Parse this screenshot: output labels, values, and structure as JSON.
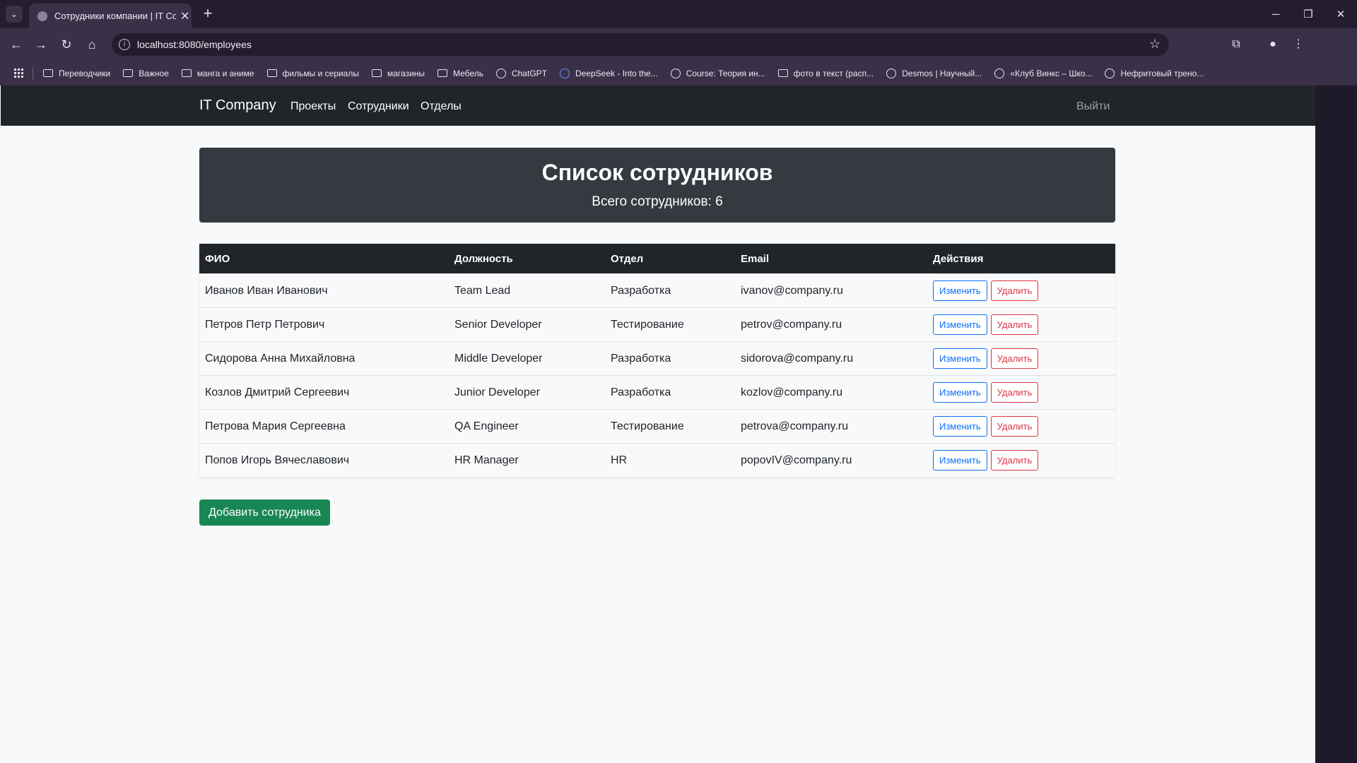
{
  "browser": {
    "tab_title": "Сотрудники компании | IT Co",
    "new_tab": "+",
    "url": "localhost:8080/employees",
    "bookmarks": [
      "Переводчики",
      "Важное",
      "манга и аниме",
      "фильмы и сериалы",
      "магазины",
      "Мебель",
      "ChatGPT",
      "DeepSeek - Into the...",
      "Course: Теория ин...",
      "фото в текст (расп...",
      "Desmos | Научный...",
      "«Клуб Винкс – Шко...",
      "Нефритовый трено..."
    ]
  },
  "navbar": {
    "brand": "IT Company",
    "links": [
      "Проекты",
      "Сотрудники",
      "Отделы"
    ],
    "logout": "Выйти"
  },
  "header": {
    "title": "Список сотрудников",
    "subtitle": "Всего сотрудников: 6"
  },
  "table": {
    "columns": [
      "ФИО",
      "Должность",
      "Отдел",
      "Email",
      "Действия"
    ],
    "rows": [
      {
        "name": "Иванов Иван Иванович",
        "position": "Team Lead",
        "department": "Разработка",
        "email": "ivanov@company.ru"
      },
      {
        "name": "Петров Петр Петрович",
        "position": "Senior Developer",
        "department": "Тестирование",
        "email": "petrov@company.ru"
      },
      {
        "name": "Сидорова Анна Михайловна",
        "position": "Middle Developer",
        "department": "Разработка",
        "email": "sidorova@company.ru"
      },
      {
        "name": "Козлов Дмитрий Сергеевич",
        "position": "Junior Developer",
        "department": "Разработка",
        "email": "kozlov@company.ru"
      },
      {
        "name": "Петрова Мария Сергеевна",
        "position": "QA Engineer",
        "department": "Тестирование",
        "email": "petrova@company.ru"
      },
      {
        "name": "Попов Игорь Вячеславович",
        "position": "HR Manager",
        "department": "HR",
        "email": "popovIV@company.ru"
      }
    ],
    "edit_label": "Изменить",
    "delete_label": "Удалить"
  },
  "add_button": "Добавить сотрудника",
  "colors": {
    "navbar": "#212529",
    "header_card": "#343a40",
    "edit": "#0d6efd",
    "delete": "#dc3545",
    "add": "#198754"
  }
}
